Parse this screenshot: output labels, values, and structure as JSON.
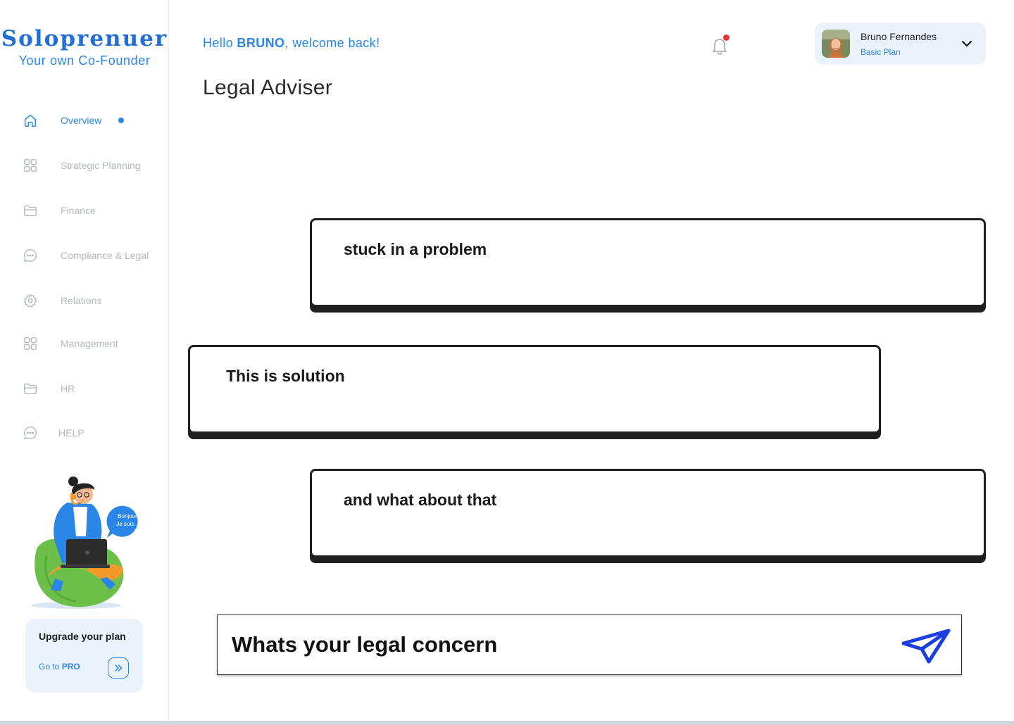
{
  "brand": {
    "name": "Soloprenuer",
    "tagline": "Your own Co-Founder"
  },
  "sidebar": {
    "items": [
      {
        "label": "Overview",
        "icon": "home-icon",
        "active": true
      },
      {
        "label": "Strategic Planning",
        "icon": "grid-icon",
        "active": false
      },
      {
        "label": "Finance",
        "icon": "folder-icon",
        "active": false
      },
      {
        "label": "Compliance & Legal",
        "icon": "chat-icon",
        "active": false
      },
      {
        "label": "Relations",
        "icon": "gear-icon",
        "active": false
      },
      {
        "label": "Management",
        "icon": "grid-icon",
        "active": false
      },
      {
        "label": "HR",
        "icon": "folder-icon",
        "active": false
      },
      {
        "label": "HELP",
        "icon": "chat-icon",
        "active": false
      }
    ],
    "illustration_bubble": [
      "Bonjour",
      "Je suis..."
    ],
    "upgrade": {
      "title": "Upgrade your plan",
      "link_prefix": "Go to ",
      "link_emphasis": "PRO"
    }
  },
  "header": {
    "greeting_prefix": "Hello ",
    "greeting_name": "BRUNO",
    "greeting_suffix": ", welcome back!",
    "page_title": "Legal Adviser",
    "notifications": {
      "has_unread": true
    },
    "user": {
      "name": "Bruno Fernandes",
      "plan": "Basic Plan"
    }
  },
  "chat": {
    "messages": [
      {
        "text": "stuck in a problem",
        "side": "right"
      },
      {
        "text": "This is solution",
        "side": "left"
      },
      {
        "text": "and what about that",
        "side": "right"
      }
    ],
    "input": {
      "placeholder": "Whats your legal concern",
      "value": ""
    }
  },
  "colors": {
    "accent": "#2a86e6",
    "brand": "#1f6fd6",
    "muted_nav": "#b3b8bf",
    "card_bg": "#eaf3fc",
    "notification_dot": "#e53935",
    "send_icon": "#1b3fe0"
  }
}
